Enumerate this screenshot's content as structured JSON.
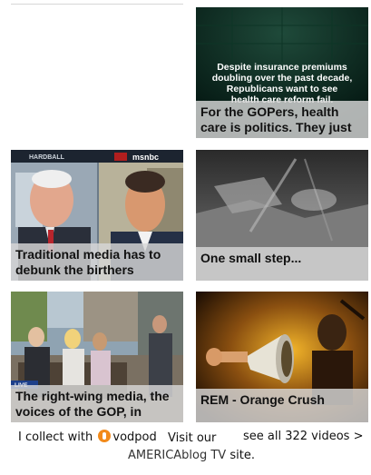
{
  "videos": [
    {
      "caption": "For the GOPers, health care is politics. They just",
      "overlay_text": "Despite insurance premiums doubling over the past decade, Republicans want to see health care reform fail."
    },
    {
      "caption": "Traditional media has to debunk the birthers",
      "overlay_text": "HARDBALL",
      "network": "msnbc"
    },
    {
      "caption": "One small step..."
    },
    {
      "caption": "The right-wing media, the voices of the GOP, in",
      "overlay_text": "LIVE"
    },
    {
      "caption": "REM - Orange Crush"
    }
  ],
  "footer": {
    "collect_prefix": "I collect with",
    "collect_brand": "vodpod",
    "visit_prefix": "Visit our",
    "visit_link": "AMERICAblog TV",
    "visit_suffix": "site.",
    "see_all": "see all 322 videos >"
  }
}
